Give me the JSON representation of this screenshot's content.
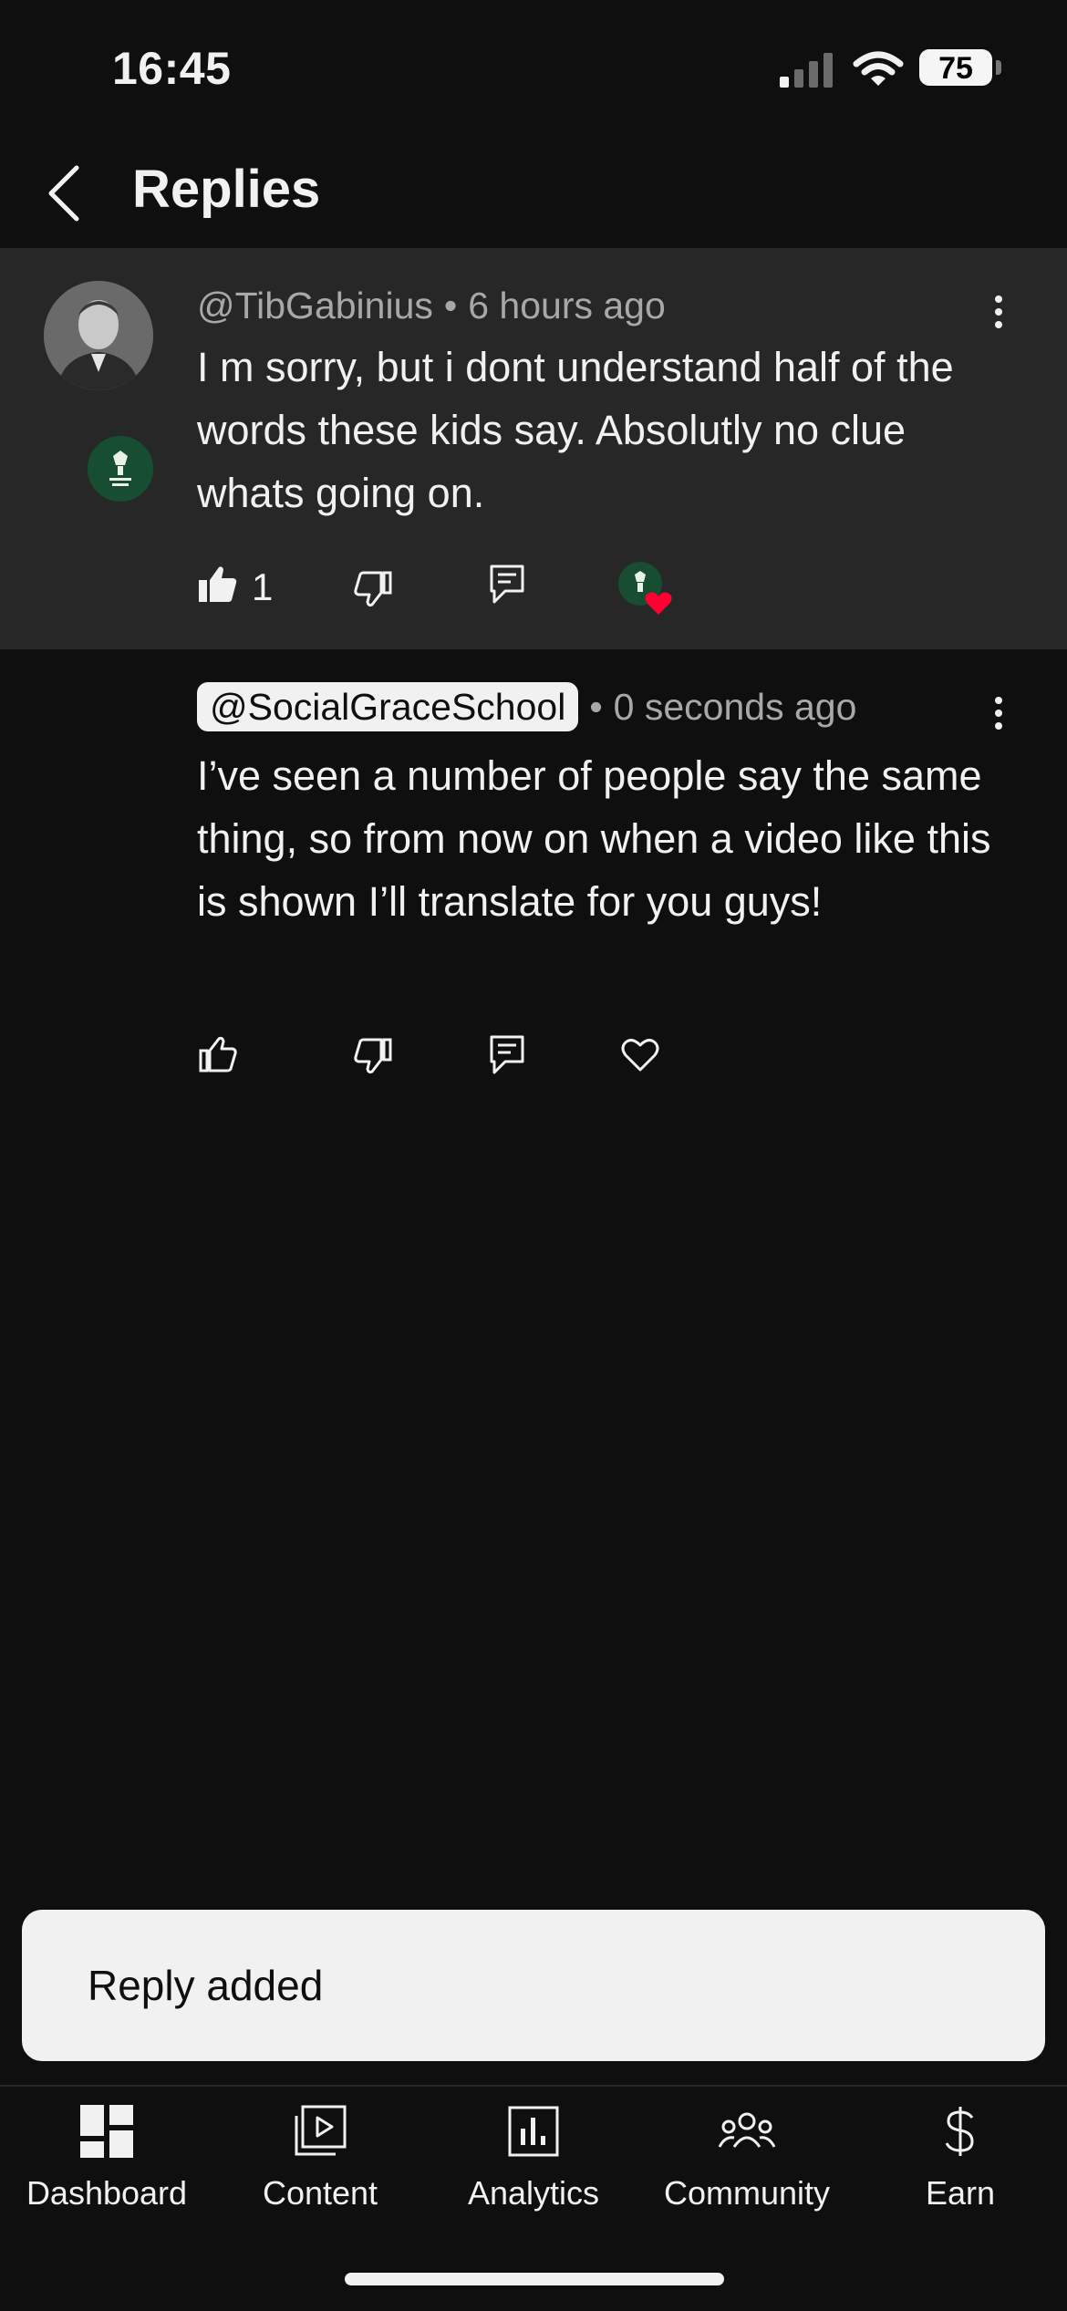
{
  "status_bar": {
    "time": "16:45",
    "battery": "75"
  },
  "header": {
    "title": "Replies"
  },
  "comments": [
    {
      "handle": "@TibGabinius",
      "age": "6 hours ago",
      "text": "I m sorry, but i dont understand half of the words these kids say. Absolutly no clue whats going on.",
      "likes": "1",
      "creator_hearted": true
    },
    {
      "handle": "@SocialGraceSchool",
      "age": "0 seconds ago",
      "text": "I’ve seen a number of people say the same thing, so from now on when a video like this is shown I’ll translate for you guys!",
      "likes": "",
      "creator_hearted": false
    }
  ],
  "toast": {
    "text": "Reply added"
  },
  "bottom_nav": [
    {
      "label": "Dashboard",
      "icon": "dashboard-icon"
    },
    {
      "label": "Content",
      "icon": "content-icon"
    },
    {
      "label": "Analytics",
      "icon": "analytics-icon"
    },
    {
      "label": "Community",
      "icon": "community-icon"
    },
    {
      "label": "Earn",
      "icon": "dollar-icon"
    }
  ],
  "colors": {
    "background": "#0f0f0f",
    "highlight": "#272727",
    "heart": "#ff0033",
    "school_brand": "#174d31"
  }
}
